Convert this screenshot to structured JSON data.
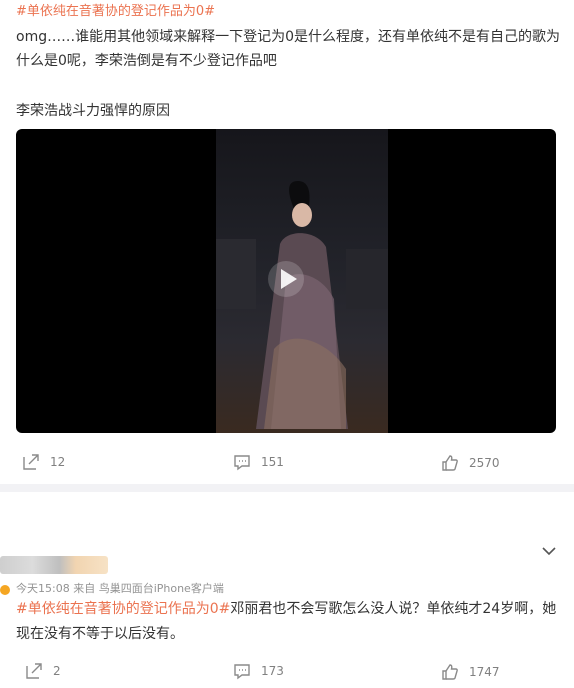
{
  "post1": {
    "hashtag": "#单依纯在音著协的登记作品为0#",
    "text_line1": "omg……谁能用其他领域来解释一下登记为0是什么程度，还有单依纯不是有自己的歌为",
    "text_line2": "什么是0呢，李荣浩倒是有不少登记作品吧",
    "text_line3": "李荣浩战斗力强悍的原因",
    "actions": {
      "repost": "12",
      "comment": "151",
      "like": "2570"
    }
  },
  "post2": {
    "meta": "今天15:08 来自 鸟巢四面台iPhone客户端",
    "hashtag": "#单依纯在音著协的登记作品为0#",
    "text_line1_rest": "邓丽君也不会写歌怎么没人说？单依纯才24岁啊，她",
    "text_line2": "现在没有不等于以后没有。",
    "actions": {
      "repost": "2",
      "comment": "173",
      "like": "1747"
    }
  },
  "colors": {
    "hashtag": "#eb7350",
    "text": "#333333",
    "meta": "#939393",
    "divider": "#f2f2f5"
  },
  "icons": [
    "repost-icon",
    "comment-icon",
    "like-icon",
    "play-icon",
    "chevron-down-icon"
  ]
}
